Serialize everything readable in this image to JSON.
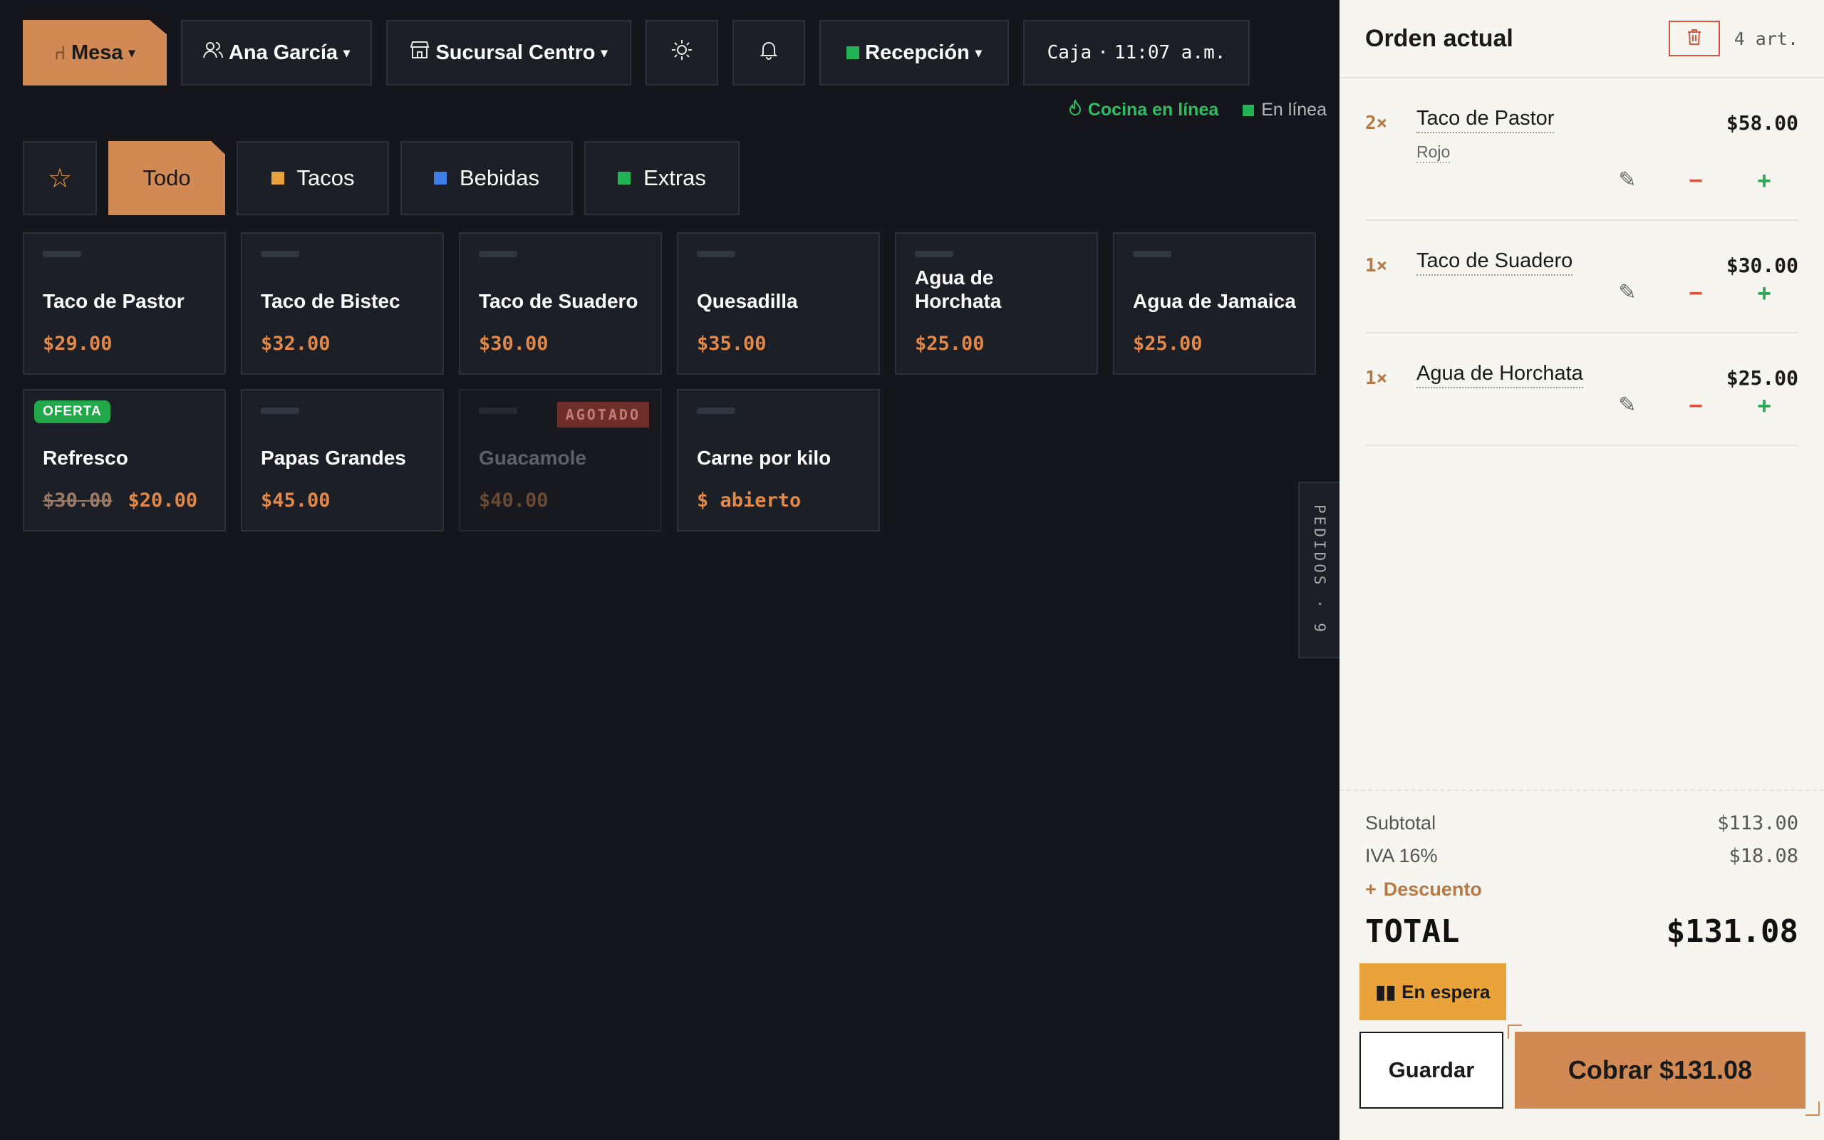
{
  "topbar": {
    "mesa_label": "Mesa",
    "user_label": "Ana García",
    "branch_label": "Sucursal Centro",
    "station_label": "Recepción",
    "register_label": "Caja",
    "register_time": "11:07 a.m."
  },
  "status": {
    "kitchen": "Cocina en línea",
    "connection": "En línea"
  },
  "categories": [
    {
      "label": "Todo",
      "active": true
    },
    {
      "label": "Tacos",
      "color": "#e9a23b"
    },
    {
      "label": "Bebidas",
      "color": "#3f7ee8"
    },
    {
      "label": "Extras",
      "color": "#22b357"
    }
  ],
  "products": [
    {
      "name": "Taco de Pastor",
      "price": "$29.00"
    },
    {
      "name": "Taco de Bistec",
      "price": "$32.00"
    },
    {
      "name": "Taco de Suadero",
      "price": "$30.00"
    },
    {
      "name": "Quesadilla",
      "price": "$35.00"
    },
    {
      "name": "Agua de Horchata",
      "price": "$25.00"
    },
    {
      "name": "Agua de Jamaica",
      "price": "$25.00"
    },
    {
      "name": "Refresco",
      "old_price": "$30.00",
      "price": "$20.00",
      "badge": "OFERTA"
    },
    {
      "name": "Papas Grandes",
      "price": "$45.00"
    },
    {
      "name": "Guacamole",
      "price": "$40.00",
      "badge": "AGOTADO"
    },
    {
      "name": "Carne por kilo",
      "price": "$ abierto"
    }
  ],
  "side_tab": "PEDIDOS · 9",
  "order": {
    "title": "Orden actual",
    "count": "4 art.",
    "items": [
      {
        "qty": "2×",
        "name": "Taco de Pastor",
        "modifier": "Rojo",
        "price": "$58.00"
      },
      {
        "qty": "1×",
        "name": "Taco de Suadero",
        "price": "$30.00"
      },
      {
        "qty": "1×",
        "name": "Agua de Horchata",
        "price": "$25.00"
      }
    ],
    "subtotal_label": "Subtotal",
    "subtotal": "$113.00",
    "tax_label": "IVA 16%",
    "tax": "$18.08",
    "discount_label": "Descuento",
    "total_label": "TOTAL",
    "total": "$131.08",
    "hold_label": "En espera",
    "save_label": "Guardar",
    "pay_label": "Cobrar $131.08"
  },
  "colors": {
    "accent": "#d18a54",
    "hold": "#eaa33a",
    "online": "#22b357",
    "danger": "#d9553f"
  }
}
